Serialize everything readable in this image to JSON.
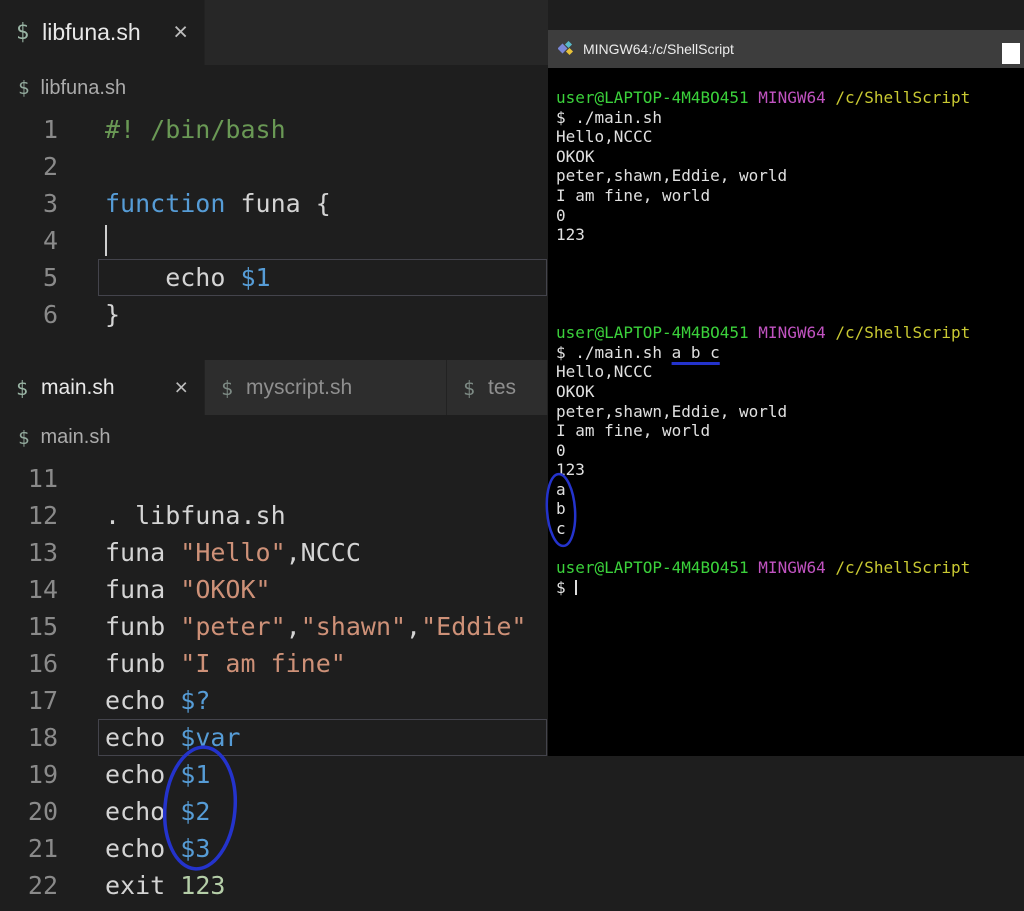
{
  "editor_top": {
    "tab": {
      "icon": "$",
      "label": "libfuna.sh",
      "close": "×"
    },
    "breadcrumb_icon": "$",
    "breadcrumb": "libfuna.sh",
    "lines": [
      {
        "n": "1",
        "segs": [
          {
            "t": "#! /bin/bash",
            "c": "comment"
          }
        ]
      },
      {
        "n": "2",
        "segs": []
      },
      {
        "n": "3",
        "segs": [
          {
            "t": "function",
            "c": "kw"
          },
          {
            "t": " funa {",
            "c": "pl"
          }
        ]
      },
      {
        "n": "4",
        "segs": [],
        "cursor": true
      },
      {
        "n": "5",
        "segs": [
          {
            "t": "    echo ",
            "c": "pl"
          },
          {
            "t": "$1",
            "c": "var"
          }
        ],
        "box": true
      },
      {
        "n": "6",
        "segs": [
          {
            "t": "}",
            "c": "pl"
          }
        ]
      }
    ]
  },
  "editor_bottom": {
    "tabs": [
      {
        "icon": "$",
        "label": "main.sh",
        "close": "×"
      },
      {
        "icon": "$",
        "label": "myscript.sh"
      },
      {
        "icon": "$",
        "label": "tes"
      }
    ],
    "breadcrumb_icon": "$",
    "breadcrumb": "main.sh",
    "lines": [
      {
        "n": "11",
        "segs": []
      },
      {
        "n": "12",
        "segs": [
          {
            "t": ". libfuna.sh",
            "c": "pl"
          }
        ]
      },
      {
        "n": "13",
        "segs": [
          {
            "t": "funa ",
            "c": "pl"
          },
          {
            "t": "\"Hello\"",
            "c": "str"
          },
          {
            "t": ",NCCC",
            "c": "pl"
          }
        ]
      },
      {
        "n": "14",
        "segs": [
          {
            "t": "funa ",
            "c": "pl"
          },
          {
            "t": "\"OKOK\"",
            "c": "str"
          }
        ]
      },
      {
        "n": "15",
        "segs": [
          {
            "t": "funb ",
            "c": "pl"
          },
          {
            "t": "\"peter\"",
            "c": "str"
          },
          {
            "t": ",",
            "c": "pl"
          },
          {
            "t": "\"shawn\"",
            "c": "str"
          },
          {
            "t": ",",
            "c": "pl"
          },
          {
            "t": "\"Eddie\"",
            "c": "str"
          }
        ]
      },
      {
        "n": "16",
        "segs": [
          {
            "t": "funb ",
            "c": "pl"
          },
          {
            "t": "\"I am fine\"",
            "c": "str"
          }
        ]
      },
      {
        "n": "17",
        "segs": [
          {
            "t": "echo ",
            "c": "pl"
          },
          {
            "t": "$?",
            "c": "var"
          }
        ]
      },
      {
        "n": "18",
        "segs": [
          {
            "t": "echo ",
            "c": "pl"
          },
          {
            "t": "$var",
            "c": "var"
          }
        ],
        "box": true
      },
      {
        "n": "19",
        "segs": [
          {
            "t": "echo ",
            "c": "pl"
          },
          {
            "t": "$1",
            "c": "var"
          }
        ]
      },
      {
        "n": "20",
        "segs": [
          {
            "t": "echo ",
            "c": "pl"
          },
          {
            "t": "$2",
            "c": "var"
          }
        ]
      },
      {
        "n": "21",
        "segs": [
          {
            "t": "echo ",
            "c": "pl"
          },
          {
            "t": "$3",
            "c": "var"
          }
        ]
      },
      {
        "n": "22",
        "segs": [
          {
            "t": "exit ",
            "c": "pl"
          },
          {
            "t": "123",
            "c": "num"
          }
        ]
      }
    ]
  },
  "terminal": {
    "title": "MINGW64:/c/ShellScript",
    "prompt": [
      {
        "t": "user@LAPTOP-4M4BO451",
        "c": "tgreen"
      },
      {
        "t": " ",
        "c": "tw"
      },
      {
        "t": "MINGW64",
        "c": "tmagenta"
      },
      {
        "t": " ",
        "c": "tw"
      },
      {
        "t": "/c/ShellScript",
        "c": "tyellow"
      }
    ],
    "lines": [
      {
        "prompt": true
      },
      {
        "segs": [
          {
            "t": "$ ./main.sh",
            "c": "tw"
          }
        ]
      },
      {
        "segs": [
          {
            "t": "Hello,NCCC",
            "c": "tw"
          }
        ]
      },
      {
        "segs": [
          {
            "t": "OKOK",
            "c": "tw"
          }
        ]
      },
      {
        "segs": [
          {
            "t": "peter,shawn,Eddie, world",
            "c": "tw"
          }
        ]
      },
      {
        "segs": [
          {
            "t": "I am fine, world",
            "c": "tw"
          }
        ]
      },
      {
        "segs": [
          {
            "t": "0",
            "c": "tw"
          }
        ]
      },
      {
        "segs": [
          {
            "t": "123",
            "c": "tw"
          }
        ]
      },
      {
        "segs": []
      },
      {
        "segs": []
      },
      {
        "segs": []
      },
      {
        "segs": []
      },
      {
        "prompt": true
      },
      {
        "segs": [
          {
            "t": "$ ./main.sh ",
            "c": "tw"
          },
          {
            "t": "a b c",
            "c": "tw",
            "u": true
          }
        ]
      },
      {
        "segs": [
          {
            "t": "Hello,NCCC",
            "c": "tw"
          }
        ]
      },
      {
        "segs": [
          {
            "t": "OKOK",
            "c": "tw"
          }
        ]
      },
      {
        "segs": [
          {
            "t": "peter,shawn,Eddie, world",
            "c": "tw"
          }
        ]
      },
      {
        "segs": [
          {
            "t": "I am fine, world",
            "c": "tw"
          }
        ]
      },
      {
        "segs": [
          {
            "t": "0",
            "c": "tw"
          }
        ]
      },
      {
        "segs": [
          {
            "t": "123",
            "c": "tw"
          }
        ]
      },
      {
        "segs": [
          {
            "t": "a",
            "c": "tw"
          }
        ]
      },
      {
        "segs": [
          {
            "t": "b",
            "c": "tw"
          }
        ]
      },
      {
        "segs": [
          {
            "t": "c",
            "c": "tw"
          }
        ]
      },
      {
        "segs": []
      },
      {
        "prompt": true
      },
      {
        "segs": [
          {
            "t": "$ ",
            "c": "tw"
          }
        ],
        "cursor": true
      }
    ]
  },
  "annotations": {
    "pen_color": "#2433cc"
  }
}
